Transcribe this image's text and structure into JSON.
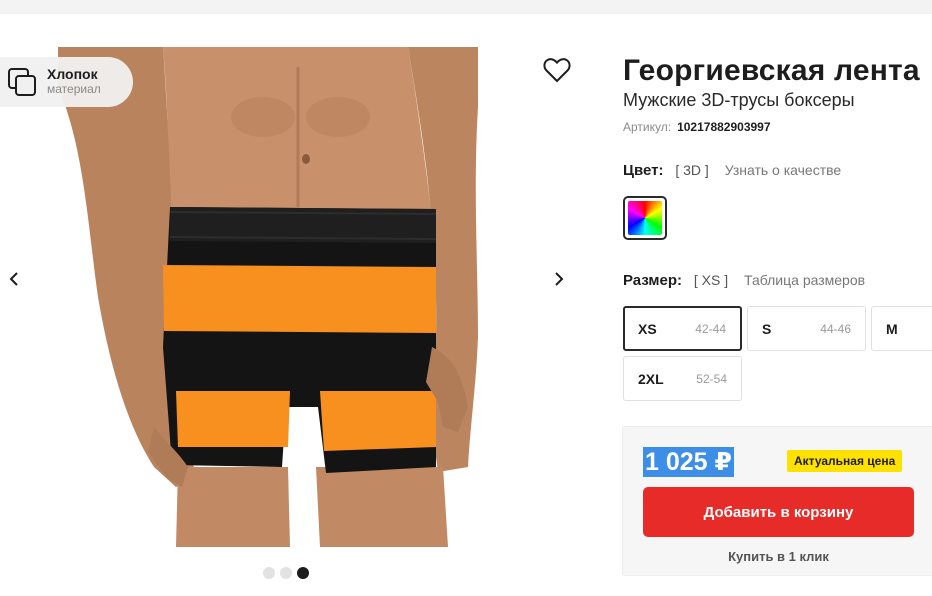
{
  "material": {
    "name": "Хлопок",
    "label": "материал",
    "icon": "layers-icon"
  },
  "product": {
    "title": "Георгиевская лента",
    "subtitle": "Мужские 3D-трусы боксеры",
    "sku_label": "Артикул:",
    "sku": "10217882903997"
  },
  "color": {
    "label": "Цвет:",
    "selected": "[ 3D ]",
    "quality_link": "Узнать о качестве",
    "swatch": "rainbow-3d"
  },
  "size": {
    "label": "Размер:",
    "selected": "[ XS ]",
    "table_link": "Таблица размеров",
    "options": [
      {
        "name": "XS",
        "range": "42-44",
        "selected": true
      },
      {
        "name": "S",
        "range": "44-46",
        "selected": false
      },
      {
        "name": "M",
        "range": "",
        "selected": false
      },
      {
        "name": "2XL",
        "range": "52-54",
        "selected": false
      }
    ]
  },
  "price": {
    "value": "1 025 ₽",
    "badge": "Актуальная цена",
    "add_to_cart": "Добавить в корзину",
    "one_click": "Купить в 1 клик"
  },
  "gallery": {
    "dots": 3,
    "active_dot": 3
  },
  "colors": {
    "stripe_orange": "#f7901e",
    "stripe_black": "#141414",
    "cart_red": "#e72b29",
    "badge_yellow": "#ffe100",
    "price_highlight": "#3d8ee6"
  }
}
